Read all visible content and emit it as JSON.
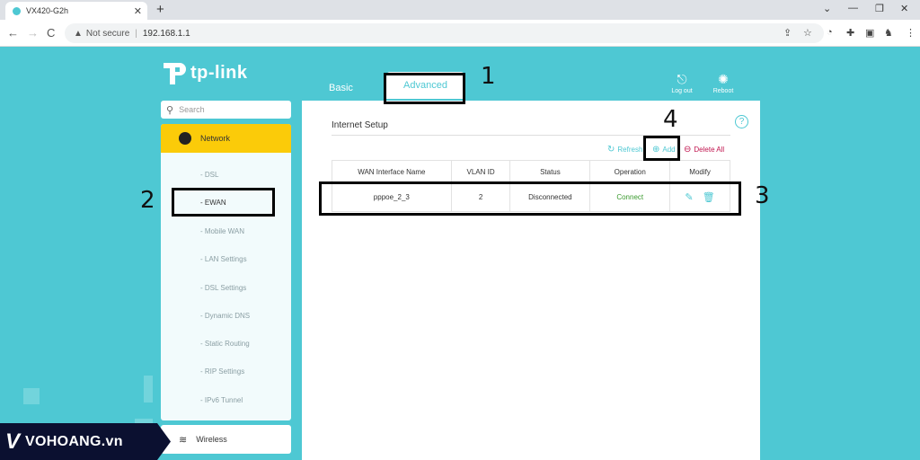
{
  "browser": {
    "tab_title": "VX420-G2h",
    "new_tab": "+",
    "back": "←",
    "forward": "→",
    "reload": "C",
    "not_secure": "Not secure",
    "url": "192.168.1.1",
    "close_tab": "✕"
  },
  "brand": {
    "logo_text": "tp-link"
  },
  "header": {
    "tab_basic": "Basic",
    "tab_advanced": "Advanced",
    "logout_label": "Log out",
    "reboot_label": "Reboot"
  },
  "sidebar": {
    "search_placeholder": "Search",
    "section": "Network",
    "items": [
      "- DSL",
      "- EWAN",
      "- Mobile WAN",
      "- LAN Settings",
      "- DSL Settings",
      "- Dynamic DNS",
      "- Static Routing",
      "- RIP Settings",
      "- IPv6 Tunnel"
    ],
    "wireless": "Wireless"
  },
  "panel": {
    "title": "Internet Setup",
    "refresh": "Refresh",
    "add": "Add",
    "delete_all": "Delete All",
    "help": "?",
    "columns": [
      "WAN Interface Name",
      "VLAN ID",
      "Status",
      "Operation",
      "Modify"
    ],
    "rows": [
      {
        "name": "pppoe_2_3",
        "vlan": "2",
        "status": "Disconnected",
        "operation": "Connect"
      }
    ]
  },
  "annotations": [
    "1",
    "2",
    "3",
    "4"
  ],
  "watermark": {
    "mark": "V",
    "text": "VOHOANG.vn"
  },
  "colors": {
    "accent": "#4ec8d3",
    "highlight": "#fbcb09",
    "danger": "#c0144e",
    "connect": "#3a9a2e"
  }
}
